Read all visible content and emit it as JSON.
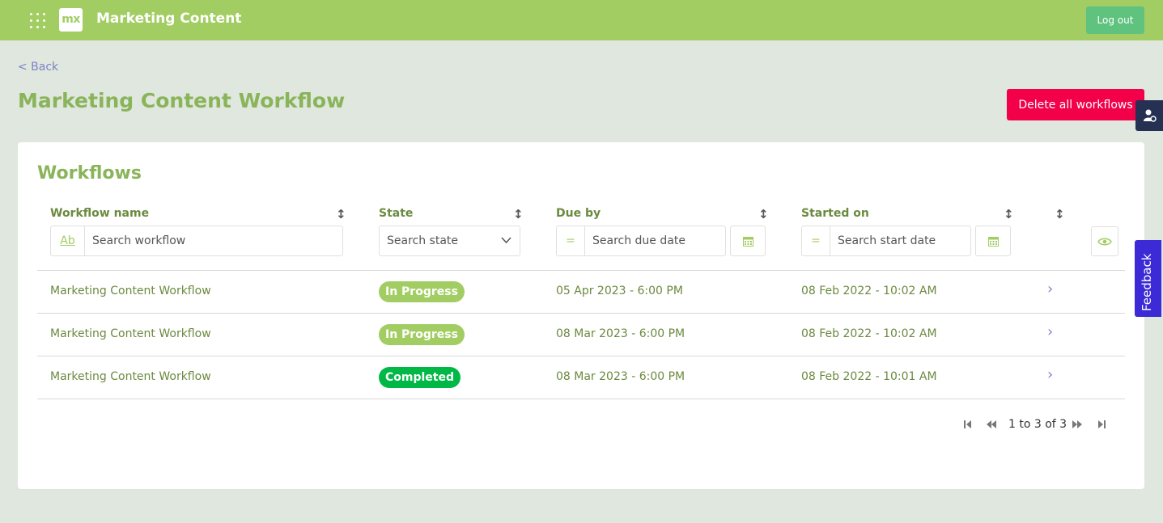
{
  "header": {
    "app_title": "Marketing Content",
    "logo_text": "mx",
    "logout_label": "Log out"
  },
  "nav": {
    "back_label": "< Back"
  },
  "page": {
    "title": "Marketing Content Workflow",
    "delete_all_label": "Delete all workflows"
  },
  "workflows": {
    "title": "Workflows",
    "columns": {
      "name": "Workflow name",
      "state": "State",
      "due_by": "Due by",
      "started_on": "Started on"
    },
    "filters": {
      "name_prefix": "Ab",
      "name_placeholder": "Search workflow",
      "state_placeholder": "Search state",
      "due_prefix": "=",
      "due_placeholder": "Search due date",
      "start_prefix": "=",
      "start_placeholder": "Search start date"
    },
    "rows": [
      {
        "name": "Marketing Content Workflow",
        "state": "In Progress",
        "due_by": "05 Apr 2023 - 6:00 PM",
        "started_on": "08 Feb 2022 - 10:02 AM"
      },
      {
        "name": "Marketing Content Workflow",
        "state": "In Progress",
        "due_by": "08 Mar 2023 - 6:00 PM",
        "started_on": "08 Feb 2022 - 10:02 AM"
      },
      {
        "name": "Marketing Content Workflow",
        "state": "Completed",
        "due_by": "08 Mar 2023 - 6:00 PM",
        "started_on": "08 Feb 2022 - 10:01 AM"
      }
    ],
    "pagination": {
      "label": "1 to 3 of 3"
    }
  },
  "feedback_label": "Feedback",
  "colors": {
    "topbar": "#a2cd63",
    "in_progress": "#a2cd63",
    "completed": "#00b846",
    "danger": "#f2004a",
    "feedback": "#3b2ad6"
  }
}
